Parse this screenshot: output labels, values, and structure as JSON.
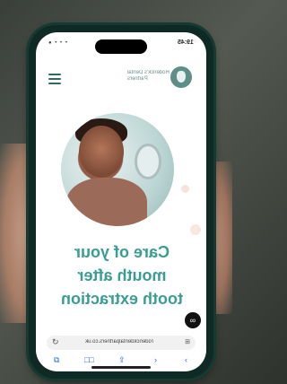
{
  "status": {
    "time": "19:45",
    "left": "● • • •"
  },
  "brand": {
    "name": "Roderick's Dental Partners"
  },
  "hero": {
    "headline_line1": "Care of your",
    "headline_line2": "mouth after",
    "headline_line3": "tooth extraction"
  },
  "browser": {
    "url": "roderickdentalpartners.co.uk",
    "reload_glyph": "↻",
    "aa_glyph": "⊞",
    "chat_glyph": "∞"
  },
  "toolbar": {
    "back": "‹",
    "forward": "›",
    "share": "⇪",
    "bookmarks": "□□",
    "tabs": "⧉"
  }
}
